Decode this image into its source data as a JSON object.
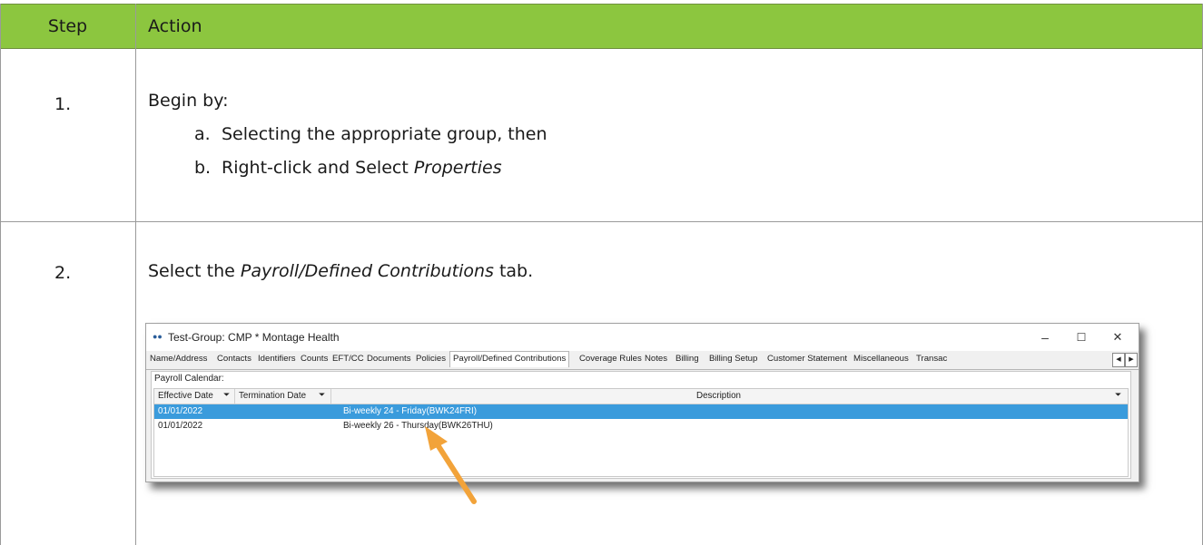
{
  "header": {
    "step": "Step",
    "action": "Action"
  },
  "steps": [
    {
      "number": "1.",
      "intro": "Begin by:",
      "items": [
        {
          "label": "a.",
          "text": "Selecting the appropriate group, then"
        },
        {
          "label": "b.",
          "text_prefix": "Right-click and Select ",
          "text_em": "Properties"
        }
      ]
    },
    {
      "number": "2.",
      "text_prefix": "Select the ",
      "text_em": "Payroll/Defined Contributions",
      "text_suffix": " tab."
    }
  ],
  "window": {
    "title": "Test-Group: CMP * Montage Health",
    "tabs": [
      "Name/Address",
      "Contacts",
      "Identifiers",
      "Counts",
      "EFT/CC",
      "Documents",
      "Policies",
      "Payroll/Defined Contributions",
      "Coverage Rules",
      "Notes",
      "Billing",
      "Billing Setup",
      "Customer Statement",
      "Miscellaneous",
      "Transac"
    ],
    "active_tab": "Payroll/Defined Contributions",
    "panel_label": "Payroll Calendar:",
    "columns": [
      "Effective Date",
      "Termination Date",
      "Description"
    ],
    "rows": [
      {
        "effective": "01/01/2022",
        "termination": "",
        "description": "Bi-weekly 24 - Friday(BWK24FRI)",
        "selected": true
      },
      {
        "effective": "01/01/2022",
        "termination": "",
        "description": "Bi-weekly 26 - Thursday(BWK26THU)",
        "selected": false
      }
    ],
    "controls": {
      "minimize": "–",
      "maximize": "☐",
      "close": "✕"
    }
  },
  "colors": {
    "header_bg": "#8cc63f",
    "selected_row": "#3a9bdc",
    "arrow": "#f2a33a"
  }
}
